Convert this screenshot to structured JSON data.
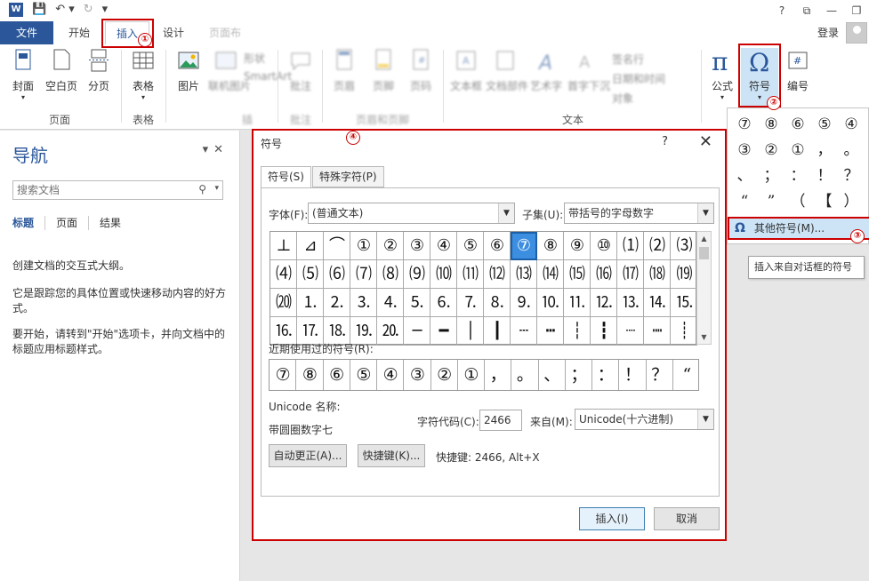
{
  "titlebar": {
    "app_icon": "W",
    "window_controls": [
      "?",
      "⧉",
      "—",
      "❐"
    ]
  },
  "tabs": {
    "file": "文件",
    "home": "开始",
    "insert": "插入",
    "design": "设计",
    "layout": "页面布"
  },
  "account": {
    "login": "登录"
  },
  "ribbon": {
    "pages": {
      "cover": "封面",
      "blank": "空白页",
      "break": "分页",
      "group": "页面"
    },
    "tables": {
      "table": "表格",
      "group": "表格"
    },
    "illustrations": {
      "picture": "图片",
      "online_pic": "联机图片",
      "shapes": "形状",
      "smartart": "SmartArt",
      "group": "插"
    },
    "comments": {
      "comment": "批注",
      "group": "批注"
    },
    "header_footer": {
      "header": "页眉",
      "footer": "页脚",
      "page_num": "页码",
      "group": "页眉和页脚"
    },
    "text": {
      "textbox": "文本框",
      "parts": "文档部件",
      "wordart": "艺术字",
      "dropcap": "首字下沉",
      "sigline": "签名行",
      "datetime": "日期和时间",
      "object": "对象",
      "group": "文本"
    },
    "symbols": {
      "equation": "公式",
      "symbol": "符号",
      "number": "编号"
    }
  },
  "nav": {
    "title": "导航",
    "search_placeholder": "搜索文档",
    "tabs": [
      "标题",
      "页面",
      "结果"
    ],
    "p1": "创建文档的交互式大纲。",
    "p2": "它是跟踪您的具体位置或快速移动内容的好方式。",
    "p3": "要开始，请转到\"开始\"选项卡，并向文档中的标题应用标题样式。"
  },
  "dialog": {
    "title": "符号",
    "help": "?",
    "close": "✕",
    "tab_symbols": "符号(S)",
    "tab_special": "特殊字符(P)",
    "font_label": "字体(F):",
    "font_value": "(普通文本)",
    "subset_label": "子集(U):",
    "subset_value": "带括号的字母数字",
    "symbols": [
      "⊥",
      "⊿",
      "⌒",
      "①",
      "②",
      "③",
      "④",
      "⑤",
      "⑥",
      "⑦",
      "⑧",
      "⑨",
      "⑩",
      "⑴",
      "⑵",
      "⑶",
      "⑷",
      "⑸",
      "⑹",
      "⑺",
      "⑻",
      "⑼",
      "⑽",
      "⑾",
      "⑿",
      "⒀",
      "⒁",
      "⒂",
      "⒃",
      "⒄",
      "⒅",
      "⒆",
      "⒇",
      "⒈",
      "⒉",
      "⒊",
      "⒋",
      "⒌",
      "⒍",
      "⒎",
      "⒏",
      "⒐",
      "⒑",
      "⒒",
      "⒓",
      "⒔",
      "⒕",
      "⒖",
      "⒗",
      "⒘",
      "⒙",
      "⒚",
      "⒛",
      "─",
      "━",
      "│",
      "┃",
      "┄",
      "┅",
      "┆",
      "┇",
      "┈",
      "┉",
      "┊"
    ],
    "selected_symbol": "⑦",
    "recent_label": "近期使用过的符号(R):",
    "recent_symbols": [
      "⑦",
      "⑧",
      "⑥",
      "⑤",
      "④",
      "③",
      "②",
      "①",
      "，",
      "。",
      "、",
      "；",
      "：",
      "！",
      "？",
      "“"
    ],
    "unicode_label": "Unicode 名称:",
    "unicode_name": "带圆圈数字七",
    "charcode_label": "字符代码(C):",
    "charcode_value": "2466",
    "from_label": "来自(M):",
    "from_value": "Unicode(十六进制)",
    "autocorrect_btn": "自动更正(A)...",
    "shortcut_btn": "快捷键(K)...",
    "shortcut_text": "快捷键: 2466, Alt+X",
    "insert_btn": "插入(I)",
    "cancel_btn": "取消"
  },
  "symbol_dropdown": {
    "symbols": [
      "⑦",
      "⑧",
      "⑥",
      "⑤",
      "④",
      "③",
      "②",
      "①",
      "，",
      "。",
      "、",
      "；",
      "：",
      "！",
      "？",
      "“",
      "”",
      "（",
      "【",
      "）"
    ],
    "more": "其他符号(M)...",
    "tooltip": "插入来自对话框的符号"
  },
  "markers": [
    "①",
    "②",
    "③",
    "④"
  ],
  "colors": {
    "accent": "#2b579a",
    "highlight": "#cc0000",
    "selection": "#3c8ee0"
  }
}
